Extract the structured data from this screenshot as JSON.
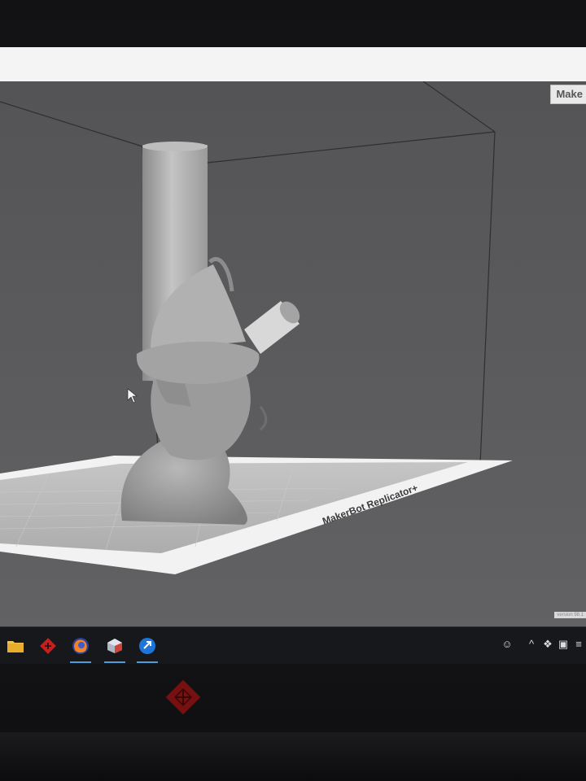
{
  "app": {
    "name_tag": "Make",
    "bed_label": "MakerBot Replicator+",
    "version_label": "version 98.1"
  },
  "viewport": {
    "model_description": "3D model on build plate",
    "colors": {
      "background": "#5d5d5f",
      "model": "#a9a9a9",
      "plate": "#bdbdbd",
      "plate_edge": "#f3f3f3"
    }
  },
  "taskbar": {
    "apps": [
      {
        "name": "File Explorer",
        "icon": "folder-icon"
      },
      {
        "name": "Omen",
        "icon": "omen-icon"
      },
      {
        "name": "Firefox",
        "icon": "firefox-icon"
      },
      {
        "name": "MakerBot Print",
        "icon": "makerbot-icon"
      },
      {
        "name": "Remote",
        "icon": "remote-icon"
      }
    ],
    "tray_icons": [
      "people-icon",
      "chevron-up-icon",
      "dropbox-icon",
      "network-icon",
      "wifi-icon"
    ]
  },
  "monitor": {
    "brand_icon": "omen-logo-icon"
  }
}
